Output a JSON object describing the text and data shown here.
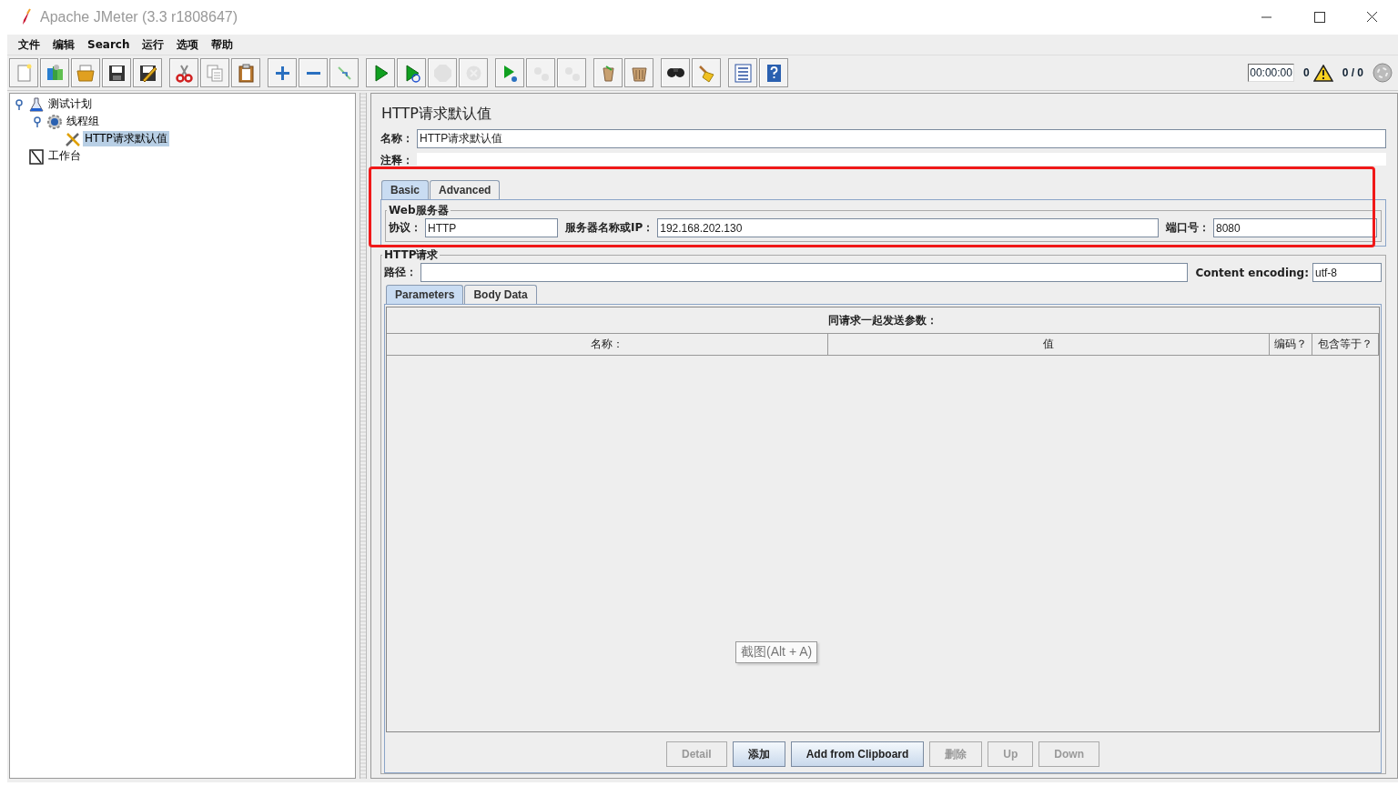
{
  "window": {
    "title": "Apache JMeter (3.3 r1808647)"
  },
  "menu": [
    "文件",
    "编辑",
    "Search",
    "运行",
    "选项",
    "帮助"
  ],
  "toolbar": [
    [
      {
        "kind": "new",
        "disabled": false
      },
      {
        "kind": "templates",
        "disabled": false
      },
      {
        "kind": "open",
        "disabled": false
      },
      {
        "kind": "save",
        "disabled": false
      },
      {
        "kind": "save-as",
        "disabled": false
      }
    ],
    [
      {
        "kind": "cut",
        "disabled": false
      },
      {
        "kind": "copy",
        "disabled": false
      },
      {
        "kind": "paste",
        "disabled": false
      }
    ],
    [
      {
        "kind": "expand",
        "disabled": false
      },
      {
        "kind": "collapse",
        "disabled": false
      },
      {
        "kind": "toggle",
        "disabled": false
      }
    ],
    [
      {
        "kind": "start",
        "disabled": false
      },
      {
        "kind": "start-no-pause",
        "disabled": false
      },
      {
        "kind": "stop",
        "disabled": true
      },
      {
        "kind": "shutdown",
        "disabled": true
      }
    ],
    [
      {
        "kind": "remote-start",
        "disabled": false
      },
      {
        "kind": "remote-stop",
        "disabled": true
      },
      {
        "kind": "remote-exit",
        "disabled": true
      }
    ],
    [
      {
        "kind": "clear",
        "disabled": false
      },
      {
        "kind": "clear-all",
        "disabled": false
      }
    ],
    [
      {
        "kind": "search",
        "disabled": false
      },
      {
        "kind": "reset-search",
        "disabled": false
      }
    ],
    [
      {
        "kind": "function",
        "disabled": false
      },
      {
        "kind": "help",
        "disabled": false
      }
    ]
  ],
  "status": {
    "timer": "00:00:00",
    "warnings": "0",
    "threads": "0 / 0"
  },
  "tree": [
    {
      "label": "测试计划",
      "kind": "plan",
      "selected": false,
      "expanded": true,
      "children": [
        {
          "label": "线程组",
          "kind": "threads",
          "selected": false,
          "expanded": true,
          "children": [
            {
              "label": "HTTP请求默认值",
              "kind": "config",
              "selected": true
            }
          ]
        }
      ]
    },
    {
      "label": "工作台",
      "kind": "workbench",
      "selected": false
    }
  ],
  "editor": {
    "title": "HTTP请求默认值",
    "name_label": "名称：",
    "name_value": "HTTP请求默认值",
    "comment_label": "注释：",
    "tabs": [
      {
        "label": "Basic",
        "selected": true
      },
      {
        "label": "Advanced",
        "selected": false
      }
    ],
    "web_server": {
      "title": "Web服务器",
      "protocol_label": "协议：",
      "protocol": "HTTP",
      "server_label": "服务器名称或IP：",
      "server": "192.168.202.130",
      "port_label": "端口号：",
      "port": "8080"
    },
    "http_request": {
      "title": "HTTP请求",
      "path_label": "路径：",
      "encoding_label": "Content encoding:",
      "encoding": "utf-8"
    },
    "param_tabs": [
      {
        "label": "Parameters",
        "selected": true
      },
      {
        "label": "Body Data",
        "selected": false
      }
    ],
    "params_caption": "同请求一起发送参数：",
    "columns": [
      "名称：",
      "值",
      "编码？",
      "包含等于？"
    ],
    "buttons": [
      {
        "label": "Detail",
        "disabled": true
      },
      {
        "label": "添加",
        "disabled": false
      },
      {
        "label": "Add from Clipboard",
        "disabled": false
      },
      {
        "label": "删除",
        "disabled": true
      },
      {
        "label": "Up",
        "disabled": true
      },
      {
        "label": "Down",
        "disabled": true
      }
    ]
  },
  "tooltip": "截图(Alt + A)"
}
